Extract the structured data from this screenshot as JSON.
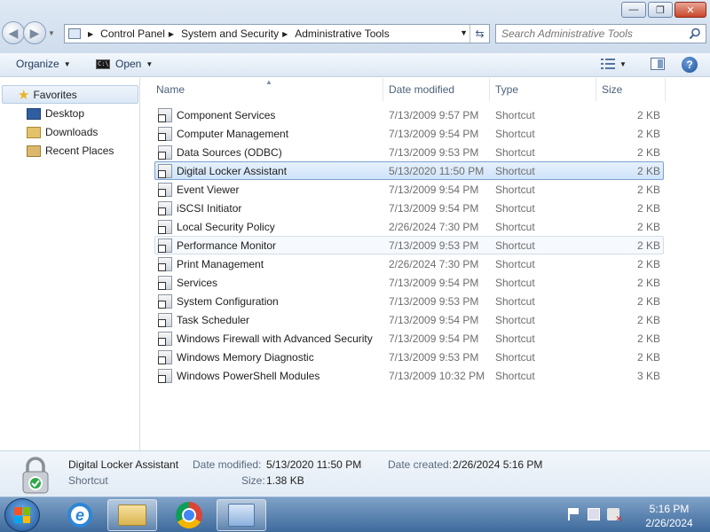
{
  "window": {
    "minimize_glyph": "—",
    "maximize_glyph": "❐",
    "close_glyph": "✕"
  },
  "address": {
    "breadcrumbs": [
      "Control Panel",
      "System and Security",
      "Administrative Tools"
    ]
  },
  "search": {
    "placeholder": "Search Administrative Tools"
  },
  "toolbar": {
    "organize_label": "Organize",
    "open_label": "Open"
  },
  "navigation": {
    "favorites_label": "Favorites",
    "items": [
      {
        "label": "Desktop",
        "icon": "desktop-icon"
      },
      {
        "label": "Downloads",
        "icon": "downloads-icon"
      },
      {
        "label": "Recent Places",
        "icon": "recent-places-icon"
      }
    ]
  },
  "columns": {
    "name": "Name",
    "date": "Date modified",
    "type": "Type",
    "size": "Size"
  },
  "files": [
    {
      "name": "Component Services",
      "date": "7/13/2009 9:57 PM",
      "type": "Shortcut",
      "size": "2 KB"
    },
    {
      "name": "Computer Management",
      "date": "7/13/2009 9:54 PM",
      "type": "Shortcut",
      "size": "2 KB"
    },
    {
      "name": "Data Sources (ODBC)",
      "date": "7/13/2009 9:53 PM",
      "type": "Shortcut",
      "size": "2 KB"
    },
    {
      "name": "Digital Locker Assistant",
      "date": "5/13/2020 11:50 PM",
      "type": "Shortcut",
      "size": "2 KB",
      "state": "selected"
    },
    {
      "name": "Event Viewer",
      "date": "7/13/2009 9:54 PM",
      "type": "Shortcut",
      "size": "2 KB"
    },
    {
      "name": "iSCSI Initiator",
      "date": "7/13/2009 9:54 PM",
      "type": "Shortcut",
      "size": "2 KB"
    },
    {
      "name": "Local Security Policy",
      "date": "2/26/2024 7:30 PM",
      "type": "Shortcut",
      "size": "2 KB"
    },
    {
      "name": "Performance Monitor",
      "date": "7/13/2009 9:53 PM",
      "type": "Shortcut",
      "size": "2 KB",
      "state": "hover"
    },
    {
      "name": "Print Management",
      "date": "2/26/2024 7:30 PM",
      "type": "Shortcut",
      "size": "2 KB"
    },
    {
      "name": "Services",
      "date": "7/13/2009 9:54 PM",
      "type": "Shortcut",
      "size": "2 KB"
    },
    {
      "name": "System Configuration",
      "date": "7/13/2009 9:53 PM",
      "type": "Shortcut",
      "size": "2 KB"
    },
    {
      "name": "Task Scheduler",
      "date": "7/13/2009 9:54 PM",
      "type": "Shortcut",
      "size": "2 KB"
    },
    {
      "name": "Windows Firewall with Advanced Security",
      "date": "7/13/2009 9:54 PM",
      "type": "Shortcut",
      "size": "2 KB"
    },
    {
      "name": "Windows Memory Diagnostic",
      "date": "7/13/2009 9:53 PM",
      "type": "Shortcut",
      "size": "2 KB"
    },
    {
      "name": "Windows PowerShell Modules",
      "date": "7/13/2009 10:32 PM",
      "type": "Shortcut",
      "size": "3 KB"
    }
  ],
  "details": {
    "name": "Digital Locker Assistant",
    "type": "Shortcut",
    "date_modified_label": "Date modified:",
    "date_modified": "5/13/2020 11:50 PM",
    "date_created_label": "Date created:",
    "date_created": "2/26/2024 5:16 PM",
    "size_label": "Size:",
    "size": "1.38 KB"
  },
  "taskbar": {
    "apps": [
      "internet-explorer-icon",
      "windows-explorer-icon",
      "chrome-icon",
      "control-panel-icon"
    ],
    "time": "5:16 PM",
    "date": "2/26/2024"
  },
  "colors": {
    "selection": "#cfe3fa",
    "selection_border": "#7da2ce",
    "taskbar": "#3e6a9c"
  }
}
